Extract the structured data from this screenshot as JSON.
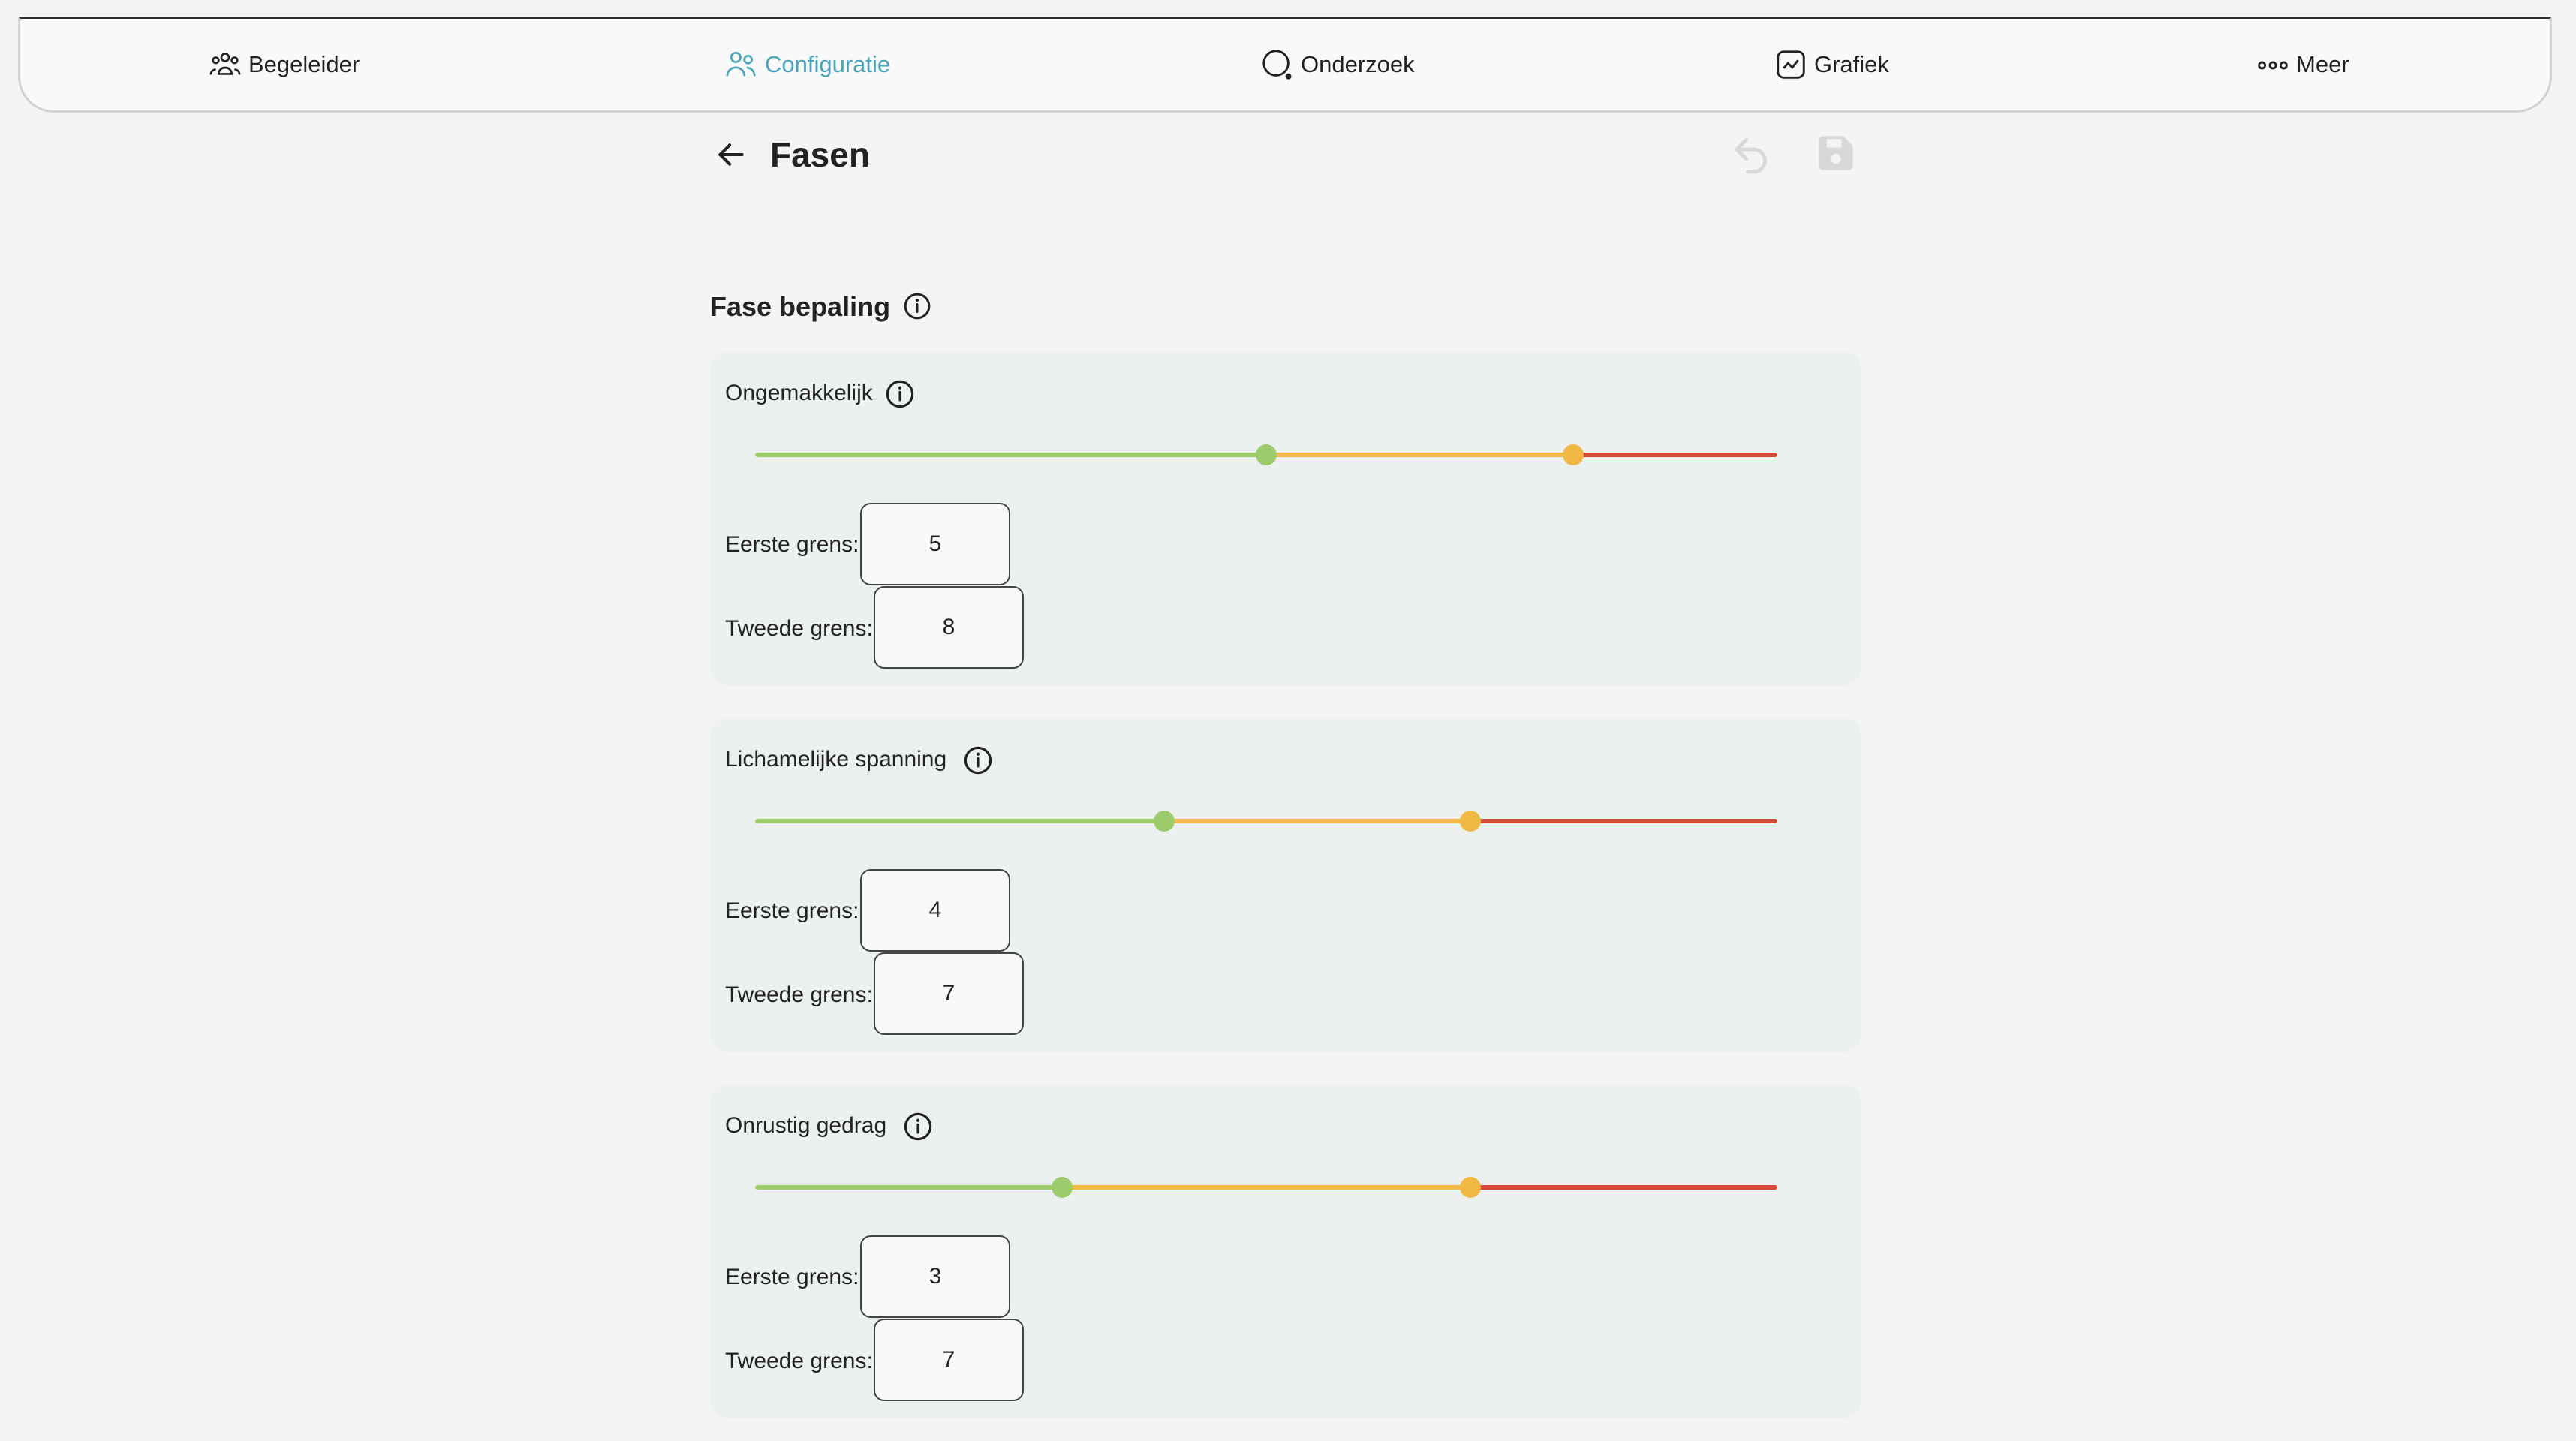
{
  "nav": {
    "items": [
      {
        "label": "Begeleider",
        "icon": "users-group-icon",
        "active": false
      },
      {
        "label": "Configuratie",
        "icon": "users-icon",
        "active": true
      },
      {
        "label": "Onderzoek",
        "icon": "search-icon",
        "active": false
      },
      {
        "label": "Grafiek",
        "icon": "chart-icon",
        "active": false
      },
      {
        "label": "Meer",
        "icon": "more-dots-icon",
        "active": false
      }
    ],
    "active_color": "#4aa3b8"
  },
  "header": {
    "title": "Fasen",
    "back_icon": "arrow-left-icon",
    "undo_icon": "undo-icon",
    "save_icon": "save-icon"
  },
  "section": {
    "title": "Fase bepaling",
    "info_icon": "info-icon"
  },
  "slider_scale": {
    "min": 0,
    "max": 10
  },
  "colors": {
    "green": "#9ecb6b",
    "orange": "#f2b845",
    "red": "#d9493a"
  },
  "labels": {
    "first": "Eerste grens:",
    "second": "Tweede grens:"
  },
  "cards": [
    {
      "label": "Ongemakkelijk",
      "first": "5",
      "second": "8"
    },
    {
      "label": "Lichamelijke spanning",
      "first": "4",
      "second": "7"
    },
    {
      "label": "Onrustig gedrag",
      "first": "3",
      "second": "7"
    }
  ]
}
